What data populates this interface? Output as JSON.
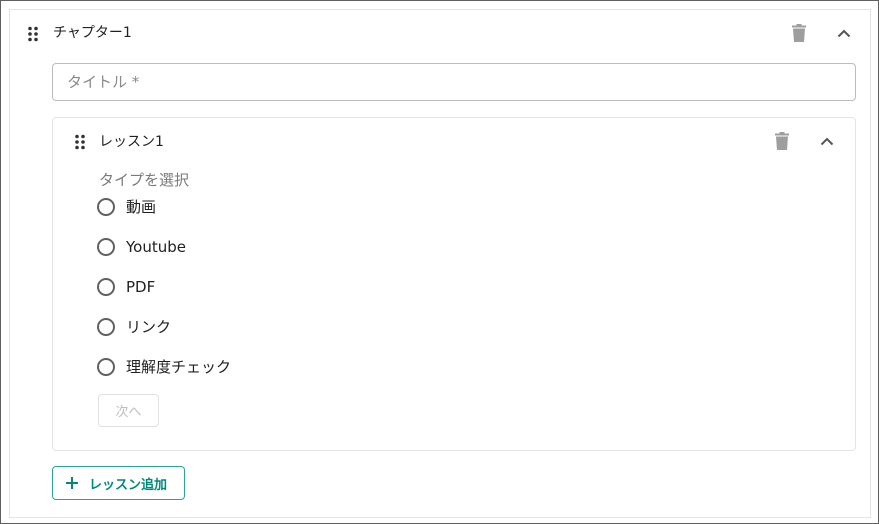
{
  "colors": {
    "accent": "#00897b",
    "accent_border": "#26a69a",
    "icon_gray": "#9e9e9e",
    "border": "#e4e4e4",
    "text": "#212121",
    "muted_text": "#7a7a7a"
  },
  "chapter": {
    "title": "チャプター1",
    "drag_icon": "drag-indicator-icon",
    "delete_icon": "trash-icon",
    "collapse_icon": "chevron-up-icon",
    "title_field": {
      "value": "",
      "placeholder": "タイトル *"
    }
  },
  "lesson": {
    "title": "レッスン1",
    "drag_icon": "drag-indicator-icon",
    "delete_icon": "trash-icon",
    "collapse_icon": "chevron-up-icon",
    "type_label": "タイプを選択",
    "options": [
      {
        "label": "動画",
        "selected": false
      },
      {
        "label": "Youtube",
        "selected": false
      },
      {
        "label": "PDF",
        "selected": false
      },
      {
        "label": "リンク",
        "selected": false
      },
      {
        "label": "理解度チェック",
        "selected": false
      }
    ],
    "next_label": "次へ"
  },
  "add_lesson": {
    "label": "レッスン追加",
    "icon": "plus-icon"
  }
}
